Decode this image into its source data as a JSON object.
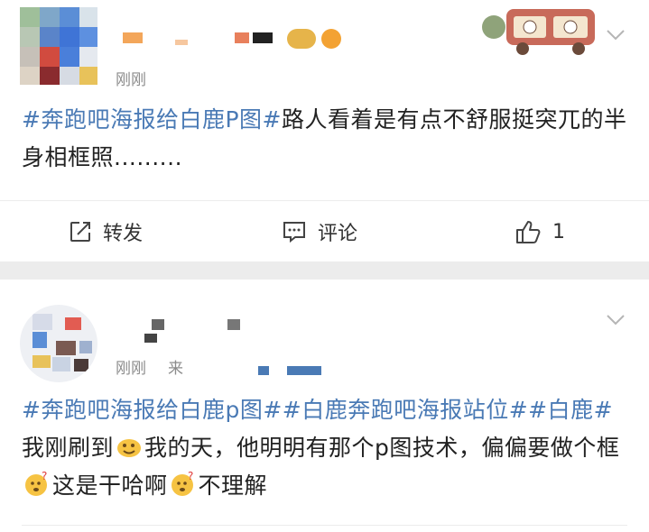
{
  "post1": {
    "time": "刚刚",
    "hashtag": "#奔跑吧海报给白鹿P图#",
    "text": "路人看着是有点不舒服挺突兀的半身相框照.........",
    "actions": {
      "repost": "转发",
      "comment": "评论",
      "like_count": "1"
    }
  },
  "post2": {
    "time": "刚刚",
    "source_prefix": "来",
    "hashtag1": "#奔跑吧海报给白鹿p图#",
    "hashtag2": "#白鹿奔跑吧海报站位#",
    "hashtag3": "#白鹿#",
    "text1": " 我刚刷到",
    "text2": "我的天，他明明有那个p图技术，偏偏要做个框",
    "text3": "这是干哈啊",
    "text4": "不理解"
  },
  "colors": {
    "hashtag": "#4a7ab5",
    "meta": "#8b8b8b",
    "divider": "#ececec"
  }
}
